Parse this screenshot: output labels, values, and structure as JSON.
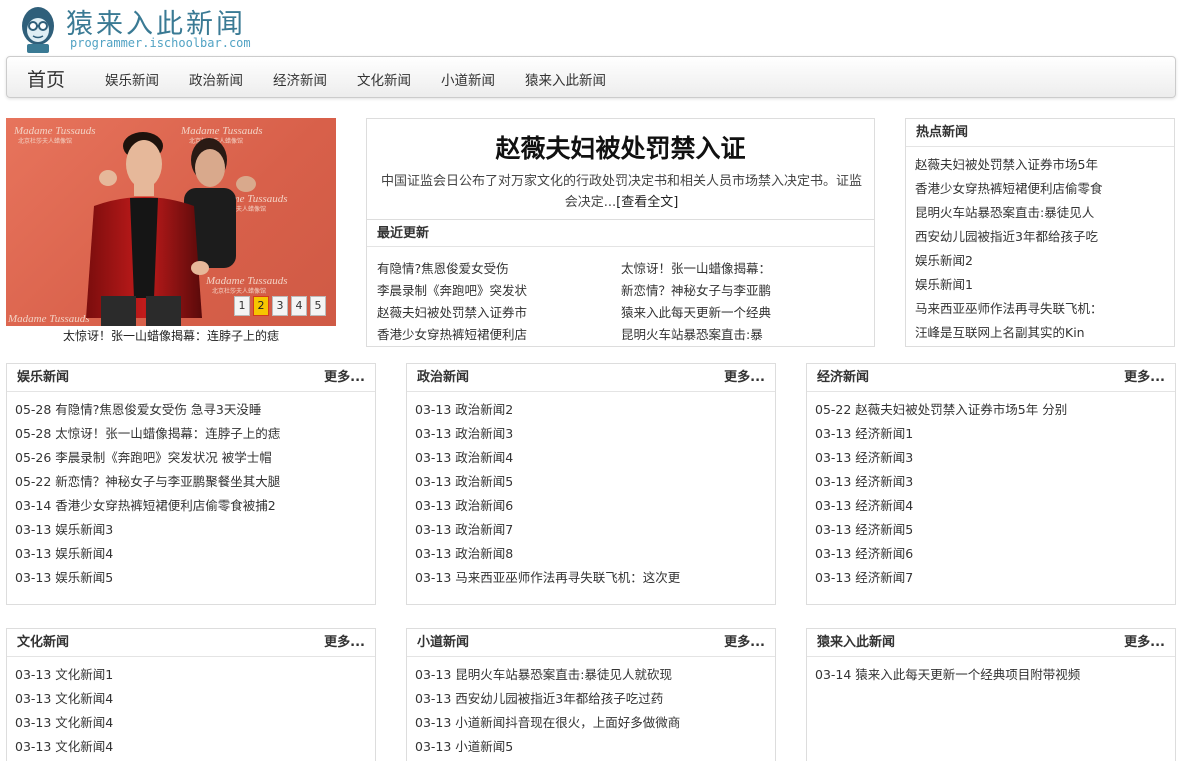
{
  "header": {
    "title": "猿来入此新闻",
    "subtitle": "programmer.ischoolbar.com",
    "mascot_icon": "monkey-mascot-icon"
  },
  "nav": {
    "home": "首页",
    "items": [
      "娱乐新闻",
      "政治新闻",
      "经济新闻",
      "文化新闻",
      "小道新闻",
      "猿来入此新闻"
    ]
  },
  "carousel": {
    "caption": "太惊讶！张一山蜡像揭幕：连脖子上的痣",
    "pages": [
      "1",
      "2",
      "3",
      "4",
      "5"
    ],
    "active_page": "2",
    "banner_text": "Madame Tussauds",
    "banner_sub": "北京杜莎夫人蜡像馆"
  },
  "headline": {
    "title": "赵薇夫妇被处罚禁入证",
    "summary": "中国证监会日公布了对万家文化的行政处罚决定书和相关人员市场禁入决定书。证监会决定...",
    "read_more": "[查看全文]"
  },
  "recent": {
    "title": "最近更新",
    "items": [
      "有隐情?焦恩俊爱女受伤",
      "太惊讶！张一山蜡像揭幕：",
      "李晨录制《奔跑吧》突发状",
      "新恋情？神秘女子与李亚鹏",
      "赵薇夫妇被处罚禁入证券市",
      "猿来入此每天更新一个经典",
      "香港少女穿热裤短裙便利店",
      "昆明火车站暴恐案直击:暴"
    ]
  },
  "hot": {
    "title": "热点新闻",
    "items": [
      "赵薇夫妇被处罚禁入证券市场5年",
      "香港少女穿热裤短裙便利店偷零食",
      "昆明火车站暴恐案直击:暴徒见人",
      "西安幼儿园被指近3年都给孩子吃",
      "娱乐新闻2",
      "娱乐新闻1",
      "马来西亚巫师作法再寻失联飞机：",
      "汪峰是互联网上名副其实的Kin"
    ]
  },
  "sections": [
    {
      "title": "娱乐新闻",
      "more": "更多...",
      "items": [
        "05-28 有隐情?焦恩俊爱女受伤 急寻3天没睡",
        "05-28 太惊讶！张一山蜡像揭幕：连脖子上的痣",
        "05-26 李晨录制《奔跑吧》突发状况 被学士帽",
        "05-22 新恋情？神秘女子与李亚鹏聚餐坐其大腿",
        "03-14 香港少女穿热裤短裙便利店偷零食被捕2",
        "03-13 娱乐新闻3",
        "03-13 娱乐新闻4",
        "03-13 娱乐新闻5"
      ]
    },
    {
      "title": "政治新闻",
      "more": "更多...",
      "items": [
        "03-13 政治新闻2",
        "03-13 政治新闻3",
        "03-13 政治新闻4",
        "03-13 政治新闻5",
        "03-13 政治新闻6",
        "03-13 政治新闻7",
        "03-13 政治新闻8",
        "03-13 马来西亚巫师作法再寻失联飞机：这次更"
      ]
    },
    {
      "title": "经济新闻",
      "more": "更多...",
      "items": [
        "05-22 赵薇夫妇被处罚禁入证券市场5年 分别",
        "03-13 经济新闻1",
        "03-13 经济新闻3",
        "03-13 经济新闻3",
        "03-13 经济新闻4",
        "03-13 经济新闻5",
        "03-13 经济新闻6",
        "03-13 经济新闻7"
      ]
    },
    {
      "title": "文化新闻",
      "more": "更多...",
      "items": [
        "03-13 文化新闻1",
        "03-13 文化新闻4",
        "03-13 文化新闻4",
        "03-13 文化新闻4"
      ]
    },
    {
      "title": "小道新闻",
      "more": "更多...",
      "items": [
        "03-13 昆明火车站暴恐案直击:暴徒见人就砍现",
        "03-13 西安幼儿园被指近3年都给孩子吃过药",
        "03-13 小道新闻抖音现在很火，上面好多做微商",
        "03-13 小道新闻5"
      ]
    },
    {
      "title": "猿来入此新闻",
      "more": "更多...",
      "items": [
        "03-14 猿来入此每天更新一个经典项目附带视频"
      ]
    }
  ]
}
